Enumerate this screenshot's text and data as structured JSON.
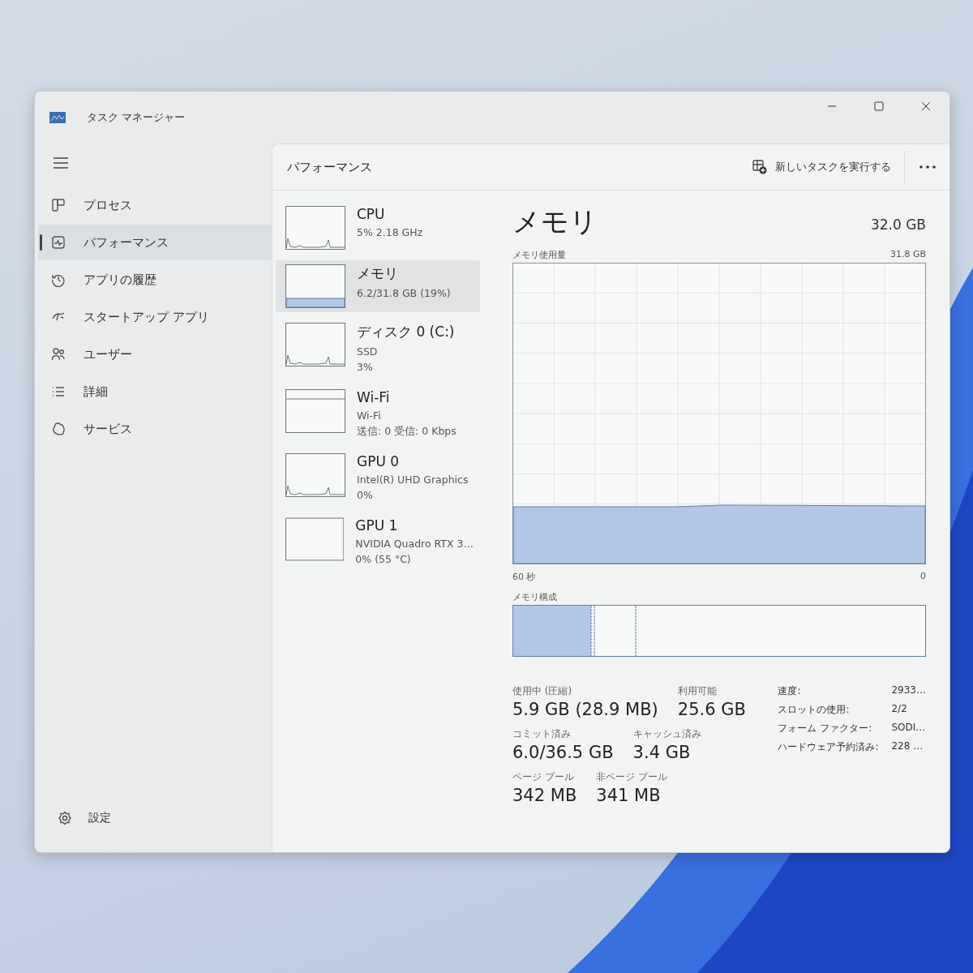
{
  "window": {
    "title": "タスク マネージャー"
  },
  "sidebar": {
    "items": [
      {
        "label": "プロセス",
        "selected": false
      },
      {
        "label": "パフォーマンス",
        "selected": true
      },
      {
        "label": "アプリの履歴",
        "selected": false
      },
      {
        "label": "スタートアップ アプリ",
        "selected": false
      },
      {
        "label": "ユーザー",
        "selected": false
      },
      {
        "label": "詳細",
        "selected": false
      },
      {
        "label": "サービス",
        "selected": false
      }
    ],
    "footer": "設定"
  },
  "page": {
    "title": "パフォーマンス",
    "run_task": "新しいタスクを実行する"
  },
  "devices": [
    {
      "kind": "line",
      "name": "CPU",
      "lines": [
        "5%  2.18 GHz"
      ],
      "selected": false
    },
    {
      "kind": "fill",
      "name": "メモリ",
      "lines": [
        "6.2/31.8 GB (19%)"
      ],
      "selected": true
    },
    {
      "kind": "line",
      "name": "ディスク 0 (C:)",
      "lines": [
        "SSD",
        "3%"
      ],
      "selected": false
    },
    {
      "kind": "split",
      "name": "Wi-Fi",
      "lines": [
        "Wi-Fi",
        "送信: 0 受信: 0 Kbps"
      ],
      "selected": false
    },
    {
      "kind": "line",
      "name": "GPU 0",
      "lines": [
        "Intel(R) UHD Graphics",
        "0%"
      ],
      "selected": false
    },
    {
      "kind": "empty",
      "name": "GPU 1",
      "lines": [
        "NVIDIA Quadro RTX 3…",
        "0% (55 °C)"
      ],
      "selected": false
    }
  ],
  "detail": {
    "title": "メモリ",
    "total": "32.0 GB",
    "graph_label": "メモリ使用量",
    "graph_max": "31.8 GB",
    "x_start": "60 秒",
    "x_end": "0",
    "composition_label": "メモリ構成",
    "stats": [
      [
        {
          "label": "使用中 (圧縮)",
          "value": "5.9 GB (28.9 MB)"
        },
        {
          "label": "利用可能",
          "value": "25.6 GB"
        }
      ],
      [
        {
          "label": "コミット済み",
          "value": "6.0/36.5 GB"
        },
        {
          "label": "キャッシュ済み",
          "value": "3.4 GB"
        }
      ],
      [
        {
          "label": "ページ プール",
          "value": "342 MB"
        },
        {
          "label": "非ページ プール",
          "value": "341 MB"
        }
      ]
    ],
    "specs": [
      {
        "label": "速度:",
        "value": "2933…"
      },
      {
        "label": "スロットの使用:",
        "value": "2/2"
      },
      {
        "label": "フォーム ファクター:",
        "value": "SODI…"
      },
      {
        "label": "ハードウェア予約済み:",
        "value": "228 …"
      }
    ]
  }
}
